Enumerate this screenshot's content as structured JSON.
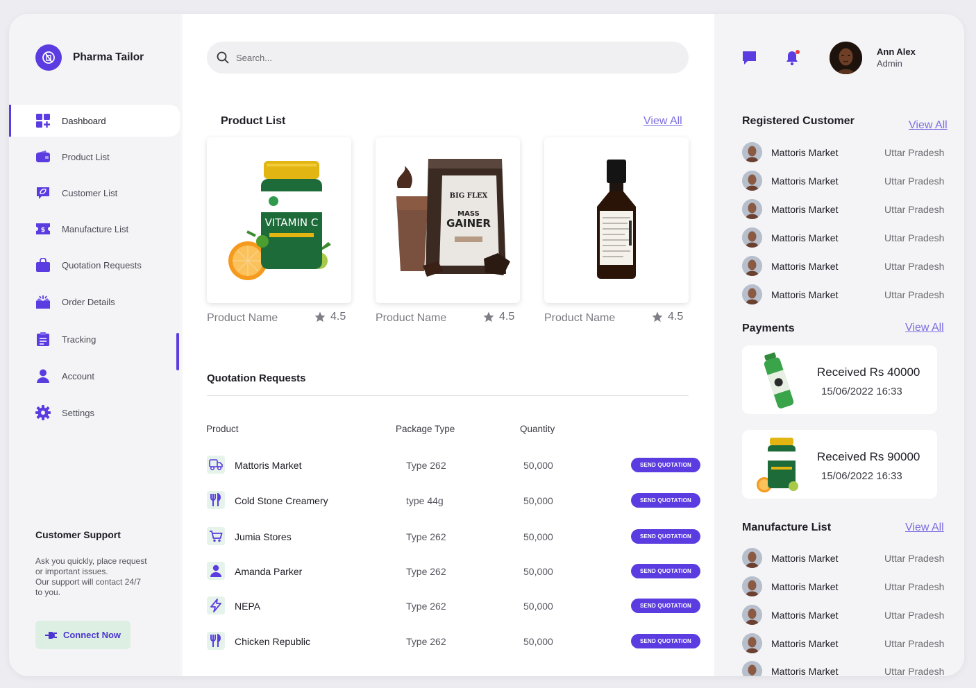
{
  "brand": {
    "name": "Pharma Tailor"
  },
  "nav": [
    {
      "label": "Dashboard",
      "icon": "dashboard-icon"
    },
    {
      "label": "Product List",
      "icon": "wallet-icon"
    },
    {
      "label": "Customer List",
      "icon": "leaf-chat-icon"
    },
    {
      "label": "Manufacture List",
      "icon": "ticket-icon"
    },
    {
      "label": "Quotation Requests",
      "icon": "bag-icon"
    },
    {
      "label": "Order Details",
      "icon": "box-icon"
    },
    {
      "label": "Tracking",
      "icon": "clipboard-icon"
    },
    {
      "label": "Account",
      "icon": "user-icon"
    },
    {
      "label": "Settings",
      "icon": "gear-icon"
    }
  ],
  "support": {
    "title": "Customer Support",
    "text_lines": [
      "Ask you quickly, place request",
      "or important issues.",
      "Our support will contact 24/7",
      "to you."
    ],
    "button": "Connect Now"
  },
  "search": {
    "placeholder": "Search..."
  },
  "products": {
    "title": "Product List",
    "view_all": "View All",
    "items": [
      {
        "name": "Product Name",
        "rating": "4.5",
        "image": "vitamin-c-jar"
      },
      {
        "name": "Product Name",
        "rating": "4.5",
        "image": "mass-gainer-pouch"
      },
      {
        "name": "Product Name",
        "rating": "4.5",
        "image": "syrup-bottle"
      }
    ]
  },
  "quotations": {
    "title": "Quotation Requests",
    "headers": [
      "Product",
      "Package Type",
      "Quantity"
    ],
    "button": "SEND QUOTATION",
    "rows": [
      {
        "name": "Mattoris Market",
        "type": "Type 262",
        "qty": "50,000",
        "icon": "truck-icon"
      },
      {
        "name": "Cold Stone Creamery",
        "type": "type 44g",
        "qty": "50,000",
        "icon": "restaurant-icon"
      },
      {
        "name": "Jumia Stores",
        "type": "Type 262",
        "qty": "50,000",
        "icon": "cart-icon"
      },
      {
        "name": "Amanda Parker",
        "type": "Type 262",
        "qty": "50,000",
        "icon": "person-icon"
      },
      {
        "name": "NEPA",
        "type": "Type 262",
        "qty": "50,000",
        "icon": "bolt-icon"
      },
      {
        "name": "Chicken Republic",
        "type": "Type 262",
        "qty": "50,000",
        "icon": "restaurant-icon"
      }
    ]
  },
  "user": {
    "name": "Ann Alex",
    "role": "Admin"
  },
  "registered": {
    "title": "Registered Customer",
    "view_all": "View All",
    "rows": [
      {
        "name": "Mattoris Market",
        "location": "Uttar Pradesh"
      },
      {
        "name": "Mattoris Market",
        "location": "Uttar Pradesh"
      },
      {
        "name": "Mattoris Market",
        "location": "Uttar Pradesh"
      },
      {
        "name": "Mattoris Market",
        "location": "Uttar Pradesh"
      },
      {
        "name": "Mattoris Market",
        "location": "Uttar Pradesh"
      },
      {
        "name": "Mattoris Market",
        "location": "Uttar Pradesh"
      }
    ]
  },
  "payments": {
    "title": "Payments",
    "view_all": "View All",
    "items": [
      {
        "title": "Received Rs 40000",
        "date": "15/06/2022 16:33",
        "image": "green-spray-can"
      },
      {
        "title": "Received Rs 90000",
        "date": "15/06/2022 16:33",
        "image": "vitamin-c-jar"
      }
    ]
  },
  "manufacture": {
    "title": "Manufacture List",
    "view_all": "View All",
    "rows": [
      {
        "name": "Mattoris Market",
        "location": "Uttar Pradesh"
      },
      {
        "name": "Mattoris Market",
        "location": "Uttar Pradesh"
      },
      {
        "name": "Mattoris Market",
        "location": "Uttar Pradesh"
      },
      {
        "name": "Mattoris Market",
        "location": "Uttar Pradesh"
      },
      {
        "name": "Mattoris Market",
        "location": "Uttar Pradesh"
      }
    ]
  },
  "colors": {
    "accent": "#5b3ce0",
    "link": "#7b6ee0",
    "support_bg": "#dcefe2"
  }
}
